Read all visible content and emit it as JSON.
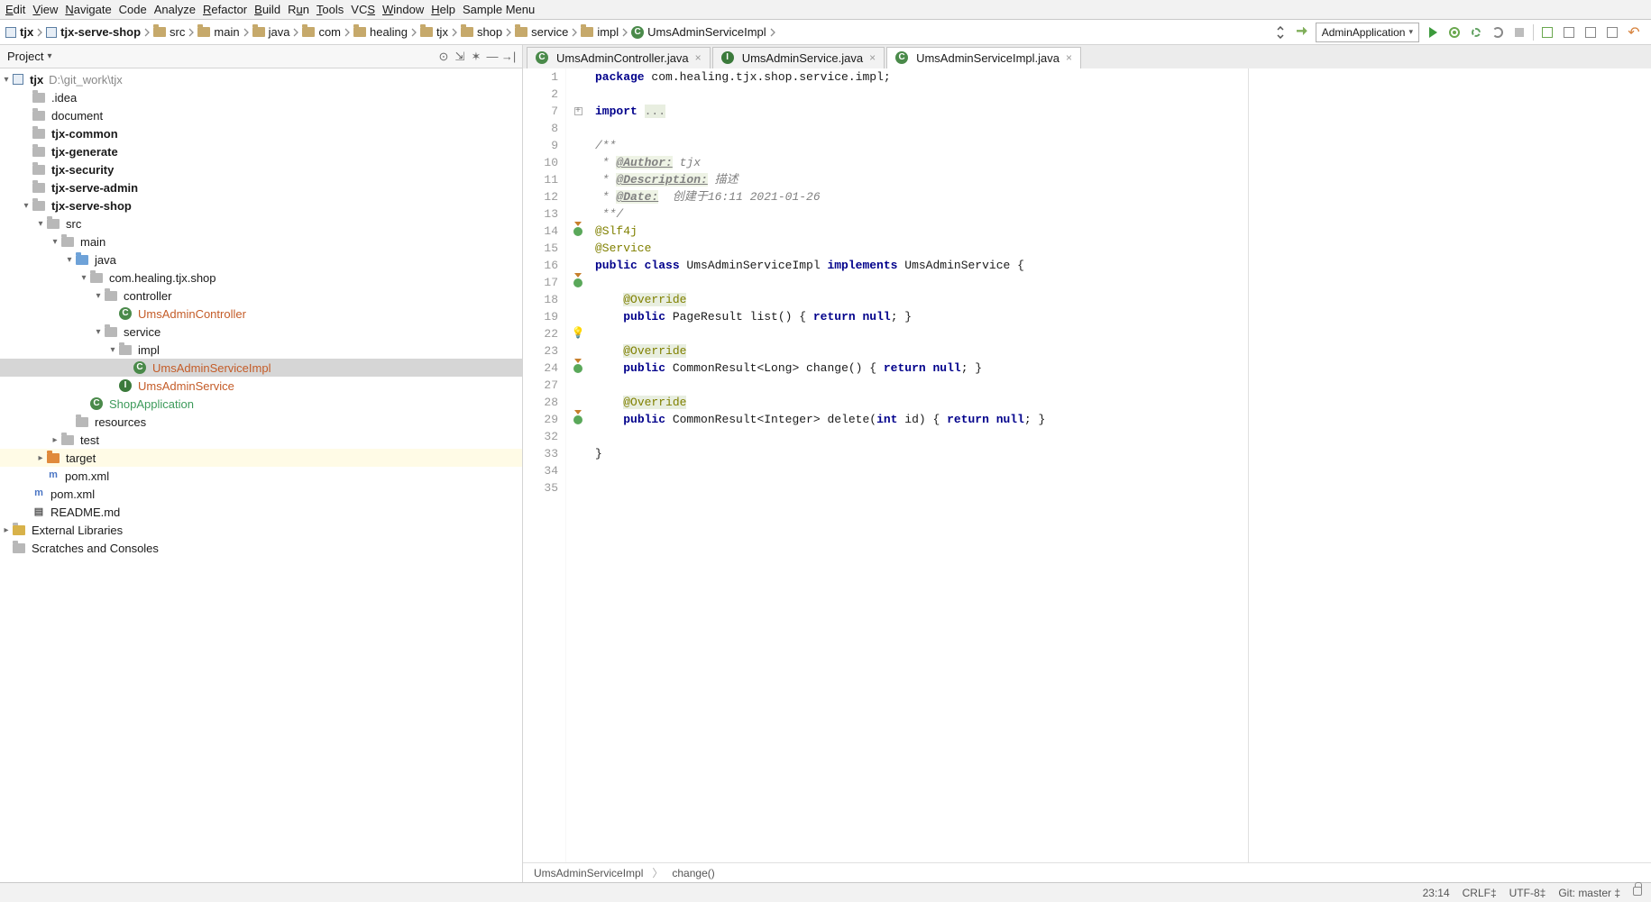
{
  "menu": [
    "Edit",
    "View",
    "Navigate",
    "Code",
    "Analyze",
    "Refactor",
    "Build",
    "Run",
    "Tools",
    "VCS",
    "Window",
    "Help",
    "Sample Menu"
  ],
  "breadcrumbs": [
    {
      "type": "module",
      "label": "tjx"
    },
    {
      "type": "module",
      "label": "tjx-serve-shop"
    },
    {
      "type": "folder",
      "label": "src"
    },
    {
      "type": "folder",
      "label": "main"
    },
    {
      "type": "folder",
      "label": "java"
    },
    {
      "type": "folder",
      "label": "com"
    },
    {
      "type": "folder",
      "label": "healing"
    },
    {
      "type": "folder",
      "label": "tjx"
    },
    {
      "type": "folder",
      "label": "shop"
    },
    {
      "type": "folder",
      "label": "service"
    },
    {
      "type": "folder",
      "label": "impl"
    },
    {
      "type": "class",
      "label": "UmsAdminServiceImpl"
    }
  ],
  "run_config": "AdminApplication",
  "project_label": "Project",
  "project_caret": "▾",
  "tree": {
    "root": {
      "label": "tjx",
      "path": "D:\\git_work\\tjx"
    },
    "items": [
      {
        "indent": 1,
        "tw": "",
        "icon": "folder-mut",
        "label": ".idea"
      },
      {
        "indent": 1,
        "tw": "",
        "icon": "folder-mut",
        "label": "document"
      },
      {
        "indent": 1,
        "tw": "",
        "icon": "folder-mut",
        "label": "tjx-common",
        "bold": true
      },
      {
        "indent": 1,
        "tw": "",
        "icon": "folder-mut",
        "label": "tjx-generate",
        "bold": true
      },
      {
        "indent": 1,
        "tw": "",
        "icon": "folder-mut",
        "label": "tjx-security",
        "bold": true
      },
      {
        "indent": 1,
        "tw": "",
        "icon": "folder-mut",
        "label": "tjx-serve-admin",
        "bold": true
      },
      {
        "indent": 1,
        "tw": "▾",
        "icon": "folder-mut",
        "label": "tjx-serve-shop",
        "bold": true
      },
      {
        "indent": 2,
        "tw": "▾",
        "icon": "folder-mut",
        "label": "src"
      },
      {
        "indent": 3,
        "tw": "▾",
        "icon": "folder-mut",
        "label": "main"
      },
      {
        "indent": 4,
        "tw": "▾",
        "icon": "folder-blue",
        "label": "java"
      },
      {
        "indent": 5,
        "tw": "▾",
        "icon": "folder-mut",
        "label": "com.healing.tjx.shop"
      },
      {
        "indent": 6,
        "tw": "▾",
        "icon": "folder-mut",
        "label": "controller"
      },
      {
        "indent": 7,
        "tw": "",
        "icon": "class",
        "label": "UmsAdminController",
        "colorClass": "shop-color"
      },
      {
        "indent": 6,
        "tw": "▾",
        "icon": "folder-mut",
        "label": "service"
      },
      {
        "indent": 7,
        "tw": "▾",
        "icon": "folder-mut",
        "label": "impl"
      },
      {
        "indent": 8,
        "tw": "",
        "icon": "class",
        "label": "UmsAdminServiceImpl",
        "colorClass": "shop-color",
        "sel": true
      },
      {
        "indent": 7,
        "tw": "",
        "icon": "iface",
        "label": "UmsAdminService",
        "colorClass": "shop-color"
      },
      {
        "indent": 5,
        "tw": "",
        "icon": "class",
        "label": "ShopApplication",
        "color": "#3c9a5a"
      },
      {
        "indent": 4,
        "tw": "",
        "icon": "folder-mut",
        "label": "resources"
      },
      {
        "indent": 3,
        "tw": "▸",
        "icon": "folder-mut",
        "label": "test"
      },
      {
        "indent": 2,
        "tw": "▸",
        "icon": "folder-orng",
        "label": "target",
        "hl": true
      },
      {
        "indent": 2,
        "tw": "",
        "icon": "m",
        "label": "pom.xml"
      },
      {
        "indent": 1,
        "tw": "",
        "icon": "m",
        "label": "pom.xml"
      },
      {
        "indent": 1,
        "tw": "",
        "icon": "md",
        "label": "README.md"
      }
    ],
    "external": "External Libraries",
    "scratches": "Scratches and Consoles"
  },
  "tabs": [
    {
      "icon": "class",
      "label": "UmsAdminController.java",
      "active": false
    },
    {
      "icon": "iface",
      "label": "UmsAdminService.java",
      "active": false
    },
    {
      "icon": "class",
      "label": "UmsAdminServiceImpl.java",
      "active": true
    }
  ],
  "code": {
    "lines": [
      1,
      2,
      7,
      8,
      9,
      10,
      11,
      12,
      13,
      14,
      15,
      16,
      17,
      18,
      19,
      22,
      23,
      24,
      27,
      28,
      29,
      32,
      33,
      34,
      35
    ],
    "package": "package ",
    "package_path": "com.healing.tjx.shop.service.impl;",
    "import": "import ",
    "import_fold": "...",
    "doc_start": "/**",
    "doc_author_tag": "@Author:",
    "doc_author_val": " tjx",
    "doc_desc_tag": "@Description:",
    "doc_desc_val": " 描述",
    "doc_date_tag": "@Date:",
    "doc_date_val": "  创建于16:11 2021-01-26",
    "doc_end": "**/",
    "ann_slf4j": "@Slf4j",
    "ann_service": "@Service",
    "class_sig_pre": "public class ",
    "class_name": "UmsAdminServiceImpl ",
    "class_impl": "implements ",
    "class_iface": "UmsAdminService {",
    "override": "@Override",
    "m1": "public PageResult list() { return null; }",
    "m2": "public CommonResult<Long> change() { return null; }",
    "m3": "public CommonResult<Integer> delete(int id) { return null; }",
    "close": "}"
  },
  "editor_crumbs": [
    "UmsAdminServiceImpl",
    "change()"
  ],
  "status": {
    "caret": "23:14",
    "line_sep": "CRLF‡",
    "encoding": "UTF-8‡",
    "git": "Git: master ‡"
  }
}
